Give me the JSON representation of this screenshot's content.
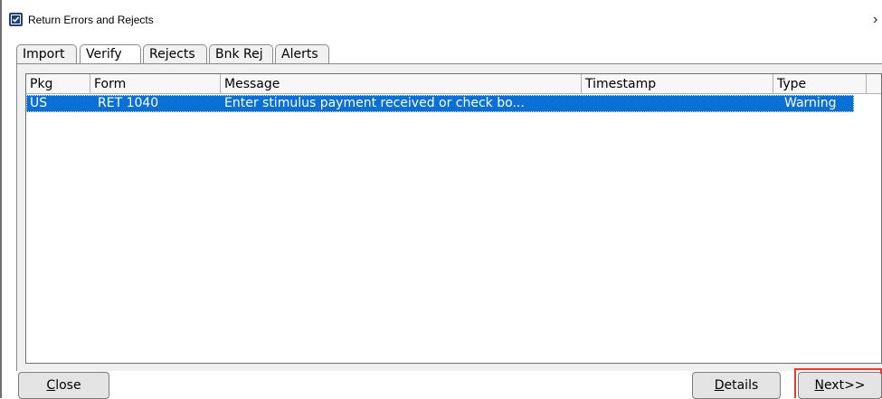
{
  "window": {
    "title": "Return Errors and Rejects",
    "close_glyph": "›",
    "icon": "app-checkbox-icon"
  },
  "tabs": [
    {
      "label": "Import",
      "active": false
    },
    {
      "label": "Verify",
      "active": true
    },
    {
      "label": "Rejects",
      "active": false
    },
    {
      "label": "Bnk Rej",
      "active": false
    },
    {
      "label": "Alerts",
      "active": false
    }
  ],
  "table": {
    "columns": [
      "Pkg",
      "Form",
      "Message",
      "Timestamp",
      "Type"
    ],
    "rows": [
      {
        "pkg": "US",
        "form": "RET 1040",
        "message": "Enter stimulus payment received or check bo...",
        "timestamp": "",
        "type": "Warning",
        "selected": true
      }
    ]
  },
  "buttons": {
    "close": {
      "mnemonic": "C",
      "rest": "lose"
    },
    "details": {
      "mnemonic": "D",
      "rest": "etails"
    },
    "next": {
      "mnemonic": "N",
      "rest": "ext>>"
    }
  },
  "colors": {
    "selection": "#0a70d6",
    "highlight_frame": "#e53935"
  }
}
